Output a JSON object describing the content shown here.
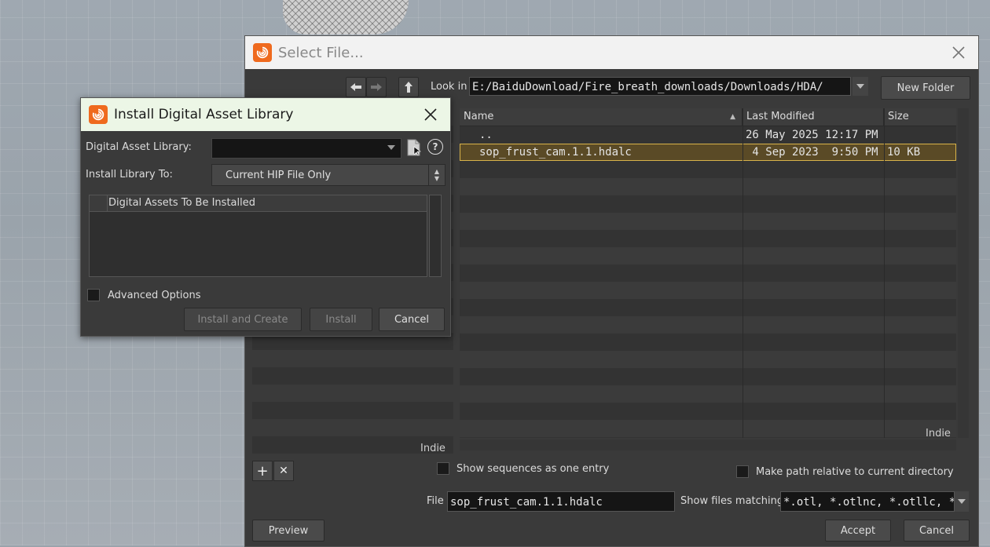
{
  "select_dialog": {
    "title": "Select File...",
    "look_in_label": "Look in",
    "look_in_path": "E:/BaiduDownload/Fire_breath_downloads/Downloads/HDA/",
    "new_folder_label": "New Folder",
    "columns": [
      "Name",
      "Last Modified",
      "Size"
    ],
    "rows": [
      {
        "name": "..",
        "modified": "26 May 2025 12:17 PM",
        "size": "",
        "icon": "folder-icon"
      },
      {
        "name": "sop_frust_cam.1.1.hdalc",
        "modified": " 4 Sep 2023  9:50 PM",
        "size": "10 KB",
        "icon": "hda-file-icon"
      }
    ],
    "left_indie": "Indie",
    "right_indie": "Indie",
    "show_sequences_label": "Show sequences as one entry",
    "make_relative_label": "Make path relative to current directory",
    "file_label": "File",
    "file_value": "sop_frust_cam.1.1.hdalc",
    "show_matching_label": "Show files matching",
    "show_matching_value": "*.otl, *.otlnc, *.otllc, *.hda, *.hdanc, *.hdalc",
    "preview_label": "Preview",
    "accept_label": "Accept",
    "cancel_label": "Cancel"
  },
  "install_dialog": {
    "title": "Install Digital Asset Library",
    "library_label": "Digital Asset Library:",
    "library_value": "",
    "install_to_label": "Install Library To:",
    "install_to_value": "Current HIP File Only",
    "assets_column": "Digital Assets To Be Installed",
    "advanced_label": "Advanced Options",
    "install_and_create_label": "Install and Create",
    "install_label": "Install",
    "cancel_label": "Cancel",
    "help_glyph": "?"
  },
  "colors": {
    "houdini_orange": "#ef6a1e",
    "selection_outline": "#d8b34a",
    "dialog_bg": "#3a3a3a"
  }
}
